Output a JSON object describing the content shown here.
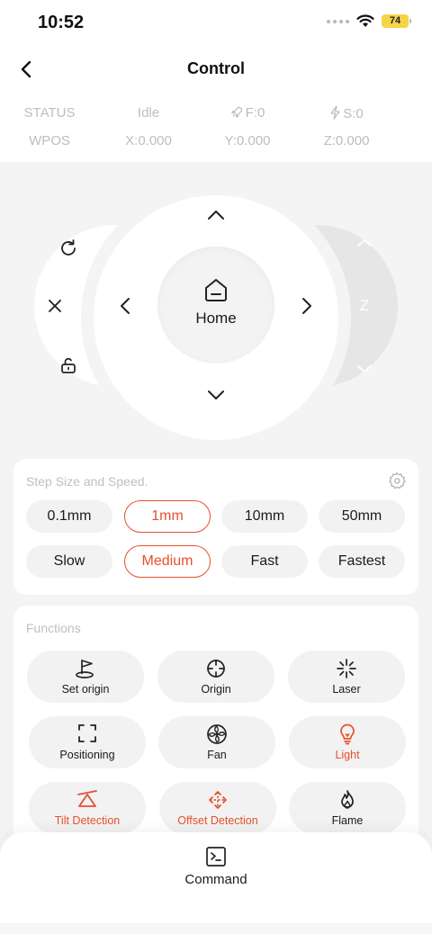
{
  "status_bar": {
    "time": "10:52",
    "battery": "74",
    "icons": [
      "cellular-dots-icon",
      "wifi-icon",
      "battery-icon"
    ]
  },
  "nav": {
    "title": "Control",
    "back_icon": "chevron-left-icon"
  },
  "info": {
    "row1": [
      "STATUS",
      "Idle",
      "F:0",
      "S:0"
    ],
    "row2": [
      "WPOS",
      "X:0.000",
      "Y:0.000",
      "Z:0.000"
    ]
  },
  "joystick": {
    "home_label": "Home",
    "z_label": "Z",
    "left_actions": [
      "refresh-icon",
      "close-icon",
      "unlock-icon"
    ]
  },
  "step": {
    "title": "Step Size and Speed.",
    "sizes": [
      "0.1mm",
      "1mm",
      "10mm",
      "50mm"
    ],
    "selected_size": "1mm",
    "speeds": [
      "Slow",
      "Medium",
      "Fast",
      "Fastest"
    ],
    "selected_speed": "Medium"
  },
  "functions": {
    "title": "Functions",
    "items": [
      {
        "label": "Set origin",
        "icon": "flag-origin-icon",
        "active": false
      },
      {
        "label": "Origin",
        "icon": "crosshair-icon",
        "active": false
      },
      {
        "label": "Laser",
        "icon": "laser-burst-icon",
        "active": false
      },
      {
        "label": "Positioning",
        "icon": "focus-frame-icon",
        "active": false
      },
      {
        "label": "Fan",
        "icon": "fan-icon",
        "active": false
      },
      {
        "label": "Light",
        "icon": "lightbulb-icon",
        "active": true
      },
      {
        "label": "Tilt Detection",
        "icon": "tilt-icon",
        "active": true
      },
      {
        "label": "Offset Detection",
        "icon": "move-arrows-icon",
        "active": true
      },
      {
        "label": "Flame",
        "icon": "flame-icon",
        "active": false
      }
    ]
  },
  "command": {
    "label": "Command",
    "icon": "terminal-icon"
  },
  "colors": {
    "accent": "#e5502e",
    "muted_text": "#bdbdbd",
    "background": "#f4f4f4"
  }
}
